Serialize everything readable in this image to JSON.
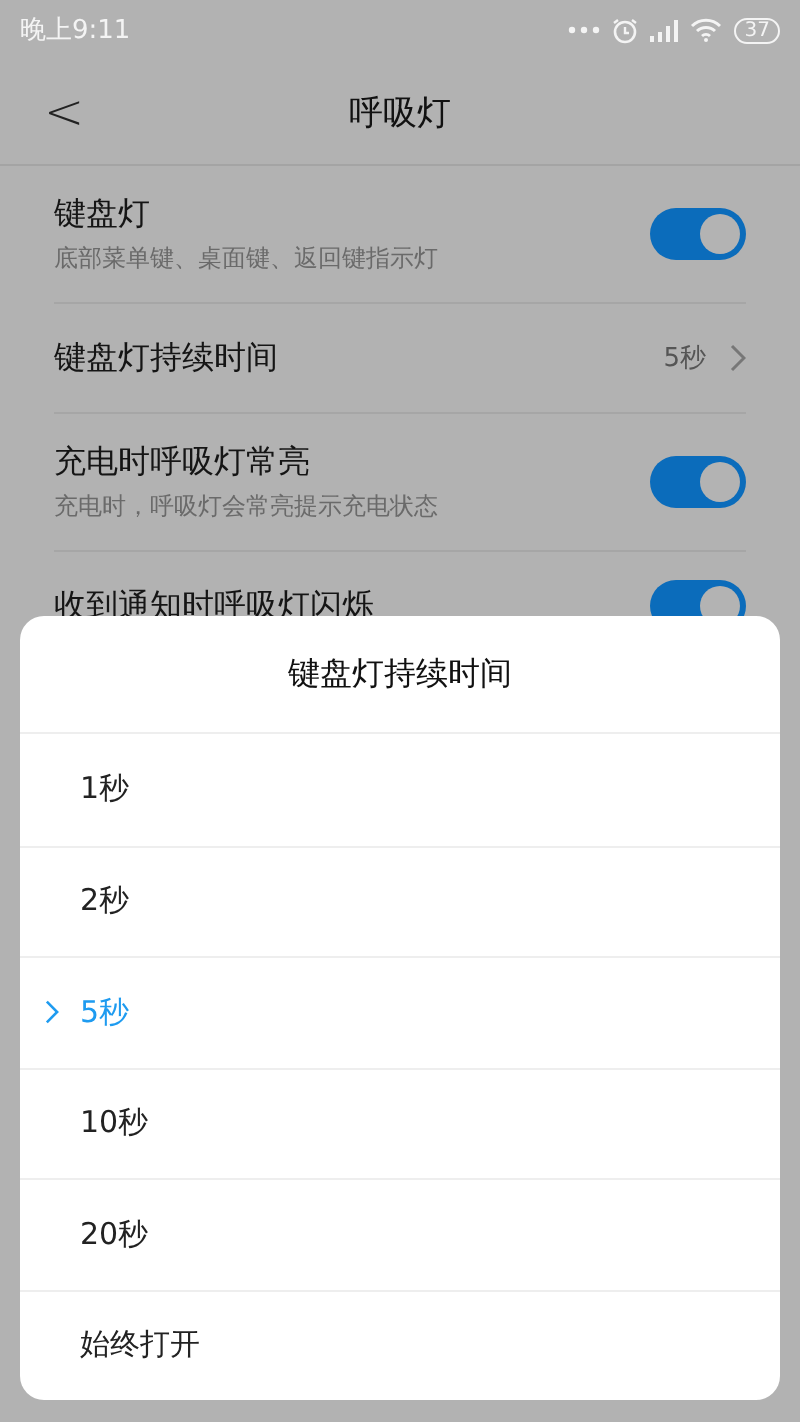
{
  "status_bar": {
    "time": "晚上9:11",
    "battery": "37"
  },
  "header": {
    "back": "<",
    "title": "呼吸灯"
  },
  "settings": [
    {
      "kind": "toggle",
      "title": "键盘灯",
      "subtitle": "底部菜单键、桌面键、返回键指示灯",
      "on": true
    },
    {
      "kind": "value",
      "title": "键盘灯持续时间",
      "value": "5秒"
    },
    {
      "kind": "toggle",
      "title": "充电时呼吸灯常亮",
      "subtitle": "充电时，呼吸灯会常亮提示充电状态",
      "on": true
    },
    {
      "kind": "toggle",
      "title": "收到通知时呼吸灯闪烁",
      "on": true
    }
  ],
  "sheet": {
    "title": "键盘灯持续时间",
    "options": [
      {
        "label": "1秒",
        "selected": false
      },
      {
        "label": "2秒",
        "selected": false
      },
      {
        "label": "5秒",
        "selected": true
      },
      {
        "label": "10秒",
        "selected": false
      },
      {
        "label": "20秒",
        "selected": false
      },
      {
        "label": "始终打开",
        "selected": false
      }
    ]
  }
}
